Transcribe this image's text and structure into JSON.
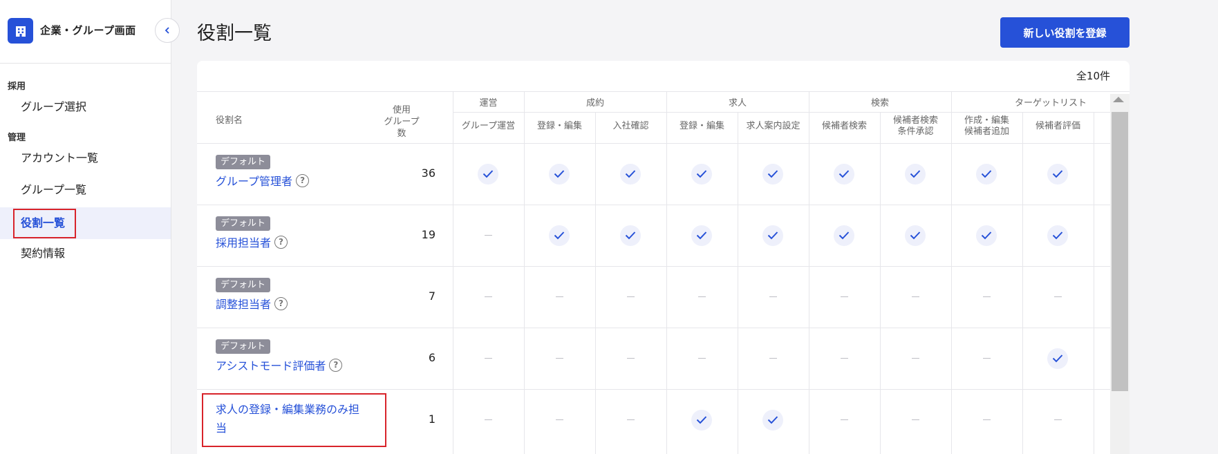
{
  "sidebar": {
    "title": "企業・グループ画面",
    "sections": [
      {
        "label": "採用",
        "items": [
          "グループ選択"
        ]
      },
      {
        "label": "管理",
        "items": [
          "アカウント一覧",
          "グループ一覧",
          "役割一覧",
          "契約情報"
        ]
      }
    ],
    "active_item": "役割一覧"
  },
  "header": {
    "title": "役割一覧",
    "new_role_button": "新しい役割を登録"
  },
  "table": {
    "total_count": "全10件",
    "col_role_name": "役割名",
    "col_used_groups": [
      "使用",
      "グループ数"
    ],
    "group_headers": [
      "運営",
      "成約",
      "求人",
      "検索",
      "ターゲットリスト"
    ],
    "sub_headers": [
      [
        "グループ運営"
      ],
      [
        "登録・編集"
      ],
      [
        "入社確認"
      ],
      [
        "登録・編集"
      ],
      [
        "求人案内設定"
      ],
      [
        "候補者検索"
      ],
      [
        "候補者検索",
        "条件承認"
      ],
      [
        "作成・編集",
        "候補者追加"
      ],
      [
        "候補者評価"
      ]
    ],
    "rows": [
      {
        "badge": "デフォルト",
        "name": "グループ管理者",
        "help": "?",
        "count": "36",
        "perms": [
          true,
          true,
          true,
          true,
          true,
          true,
          true,
          true,
          true
        ]
      },
      {
        "badge": "デフォルト",
        "name": "採用担当者",
        "help": "?",
        "count": "19",
        "perms": [
          false,
          true,
          true,
          true,
          true,
          true,
          true,
          true,
          true
        ]
      },
      {
        "badge": "デフォルト",
        "name": "調整担当者",
        "help": "?",
        "count": "7",
        "perms": [
          false,
          false,
          false,
          false,
          false,
          false,
          false,
          false,
          false
        ]
      },
      {
        "badge": "デフォルト",
        "name": "アシストモード評価者",
        "help": "?",
        "count": "6",
        "perms": [
          false,
          false,
          false,
          false,
          false,
          false,
          false,
          false,
          true
        ]
      },
      {
        "badge": "",
        "name_lines": [
          "求人の登録・編集業務のみ担",
          "当"
        ],
        "count": "1",
        "perms": [
          false,
          false,
          false,
          true,
          true,
          false,
          false,
          false,
          false
        ]
      }
    ]
  },
  "colors": {
    "accent": "#2651d8",
    "highlight": "#d8232a",
    "badge": "#8d8d99"
  }
}
